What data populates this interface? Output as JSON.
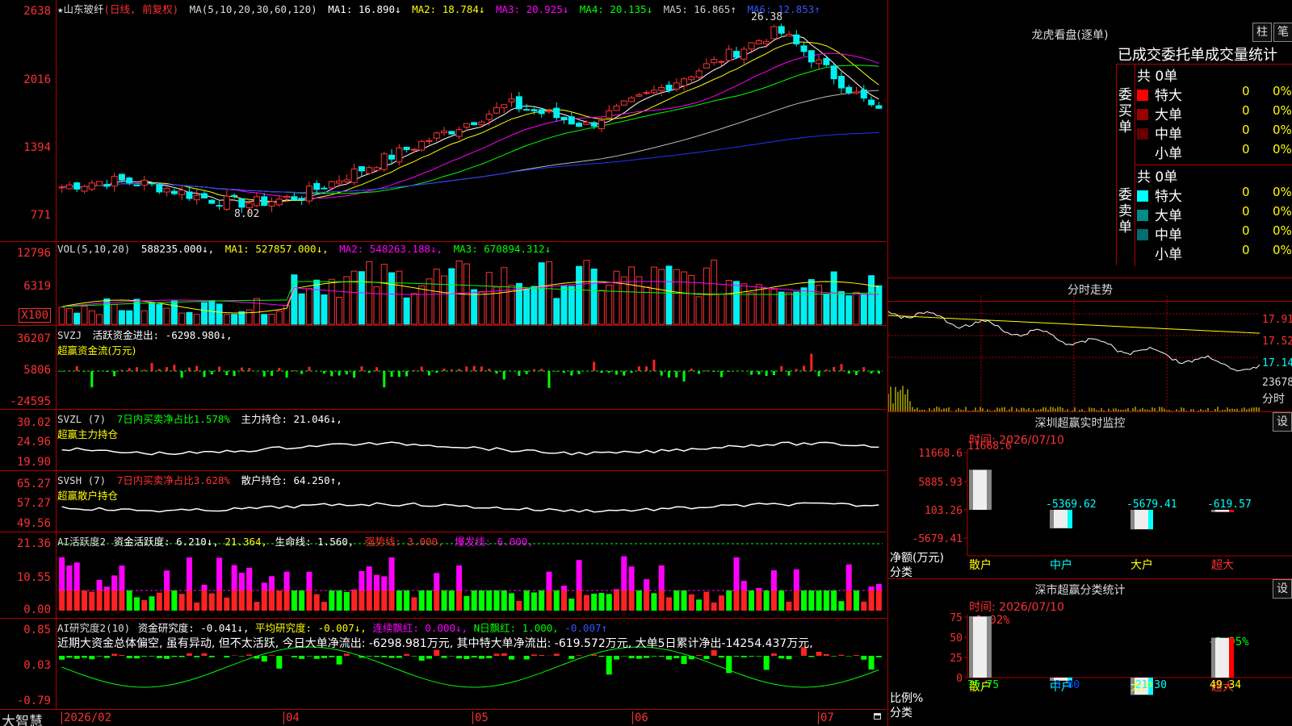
{
  "app": {
    "logo": "大智慧"
  },
  "colors": {
    "up": "#ff3333",
    "down": "#00f0f0",
    "bg": "#000000",
    "grid": "#b00000",
    "green": "#00ff00",
    "magenta": "#ff00ff",
    "yellow": "#ffff00"
  },
  "price_panel": {
    "title": "★山东玻纤",
    "period": "(日线, 前复权)",
    "ma_params": "MA(5,10,20,30,60,120)",
    "ma": [
      {
        "label": "MA1: 16.890↓",
        "color": "#ffffff"
      },
      {
        "label": "MA2: 18.784↓",
        "color": "#ffff00"
      },
      {
        "label": "MA3: 20.925↓",
        "color": "#ff00ff"
      },
      {
        "label": "MA4: 20.135↓",
        "color": "#00ff00"
      },
      {
        "label": "MA5: 16.865↑",
        "color": "#cccccc"
      },
      {
        "label": "MA6: 12.853↑",
        "color": "#0000ff"
      }
    ],
    "yticks": [
      "2638",
      "2016",
      "1394",
      "771"
    ],
    "high_label": "26.38",
    "low_label": "8.02"
  },
  "vol_panel": {
    "title": "VOL(5,10,20)",
    "value": "588235.000↓,",
    "ma": [
      {
        "label": "MA1: 527857.000↓,",
        "color": "#ffff00"
      },
      {
        "label": "MA2: 548263.188↓,",
        "color": "#ff00ff"
      },
      {
        "label": "MA3: 670894.312↓",
        "color": "#00ff00"
      }
    ],
    "yticks": [
      "12796",
      "6319"
    ],
    "unit": "X100"
  },
  "svzj_panel": {
    "title": "SVZJ",
    "line1": "活跃资金进出: -6298.980↓,",
    "line2": "超赢资金流(万元)",
    "yticks": [
      "36207",
      "5806",
      "-24595"
    ]
  },
  "svzl_panel": {
    "title": "SVZL (7)",
    "ratio": "7日内买卖净占比1.578%",
    "hold": "主力持仓: 21.046↓,",
    "line2": "超赢主力持仓",
    "yticks": [
      "30.02",
      "24.96",
      "19.90"
    ]
  },
  "svsh_panel": {
    "title": "SVSH (7)",
    "ratio": "7日内买卖净占比3.628%",
    "hold": "散户持仓: 64.250↑,",
    "line2": "超赢散户持仓",
    "yticks": [
      "65.27",
      "57.27",
      "49.56"
    ]
  },
  "ai_active_panel": {
    "title": "AI活跃度2",
    "items": [
      {
        "label": "资金活跃度: 6.210↓,",
        "color": "#ffffff"
      },
      {
        "label": "21.364,",
        "color": "#ffff00"
      },
      {
        "label": "生命线: 1.560,",
        "color": "#ffffff"
      },
      {
        "label": "强势线: 3.000,",
        "color": "#ff3030"
      },
      {
        "label": "爆发线: 6.000,",
        "color": "#ff00ff"
      }
    ],
    "yticks": [
      "21.36",
      "10.55",
      "0.00"
    ]
  },
  "ai_research_panel": {
    "title": "AI研究度2(10)",
    "items": [
      {
        "label": "资金研究度: -0.041↓,",
        "color": "#ffffff"
      },
      {
        "label": "平均研究度: -0.007↓,",
        "color": "#ffff00"
      },
      {
        "label": "连续飘红: 0.000↓,",
        "color": "#ff00ff"
      },
      {
        "label": "N日飘红: 1.000,",
        "color": "#00ff00"
      },
      {
        "label": "-0.007↑",
        "color": "#0000ff"
      }
    ],
    "comment": "近期大资金总体偏空, 虽有异动, 但不太活跃, 今日大单净流出: -6298.981万元, 其中特大单净流出: -619.572万元, 大单5日累计净出-14254.437万元,",
    "yticks": [
      "0.85",
      "0.03",
      "-0.79"
    ]
  },
  "time_axis": [
    "2026/02",
    "04",
    "05",
    "06",
    "07"
  ],
  "lhb": {
    "title": "龙虎看盘(逐单)",
    "btn1": "柱",
    "btn2": "笔",
    "tabs": "已成交委托单成交量统计",
    "buy_label": "委买单",
    "sell_label": "委卖单",
    "buy_total": "共 0单",
    "sell_total": "共 0单",
    "buy_rows": [
      {
        "name": "特大",
        "count": "0",
        "pct": "0%",
        "color": "#ff0000"
      },
      {
        "name": "大单",
        "count": "0",
        "pct": "0%",
        "color": "#990000"
      },
      {
        "name": "中单",
        "count": "0",
        "pct": "0%",
        "color": "#660000"
      },
      {
        "name": "小单",
        "count": "0",
        "pct": "0%",
        "color": ""
      }
    ],
    "sell_rows": [
      {
        "name": "特大",
        "count": "0",
        "pct": "0%",
        "color": "#00ffff"
      },
      {
        "name": "大单",
        "count": "0",
        "pct": "0%",
        "color": "#008b8b"
      },
      {
        "name": "中单",
        "count": "0",
        "pct": "0%",
        "color": "#006e6e"
      },
      {
        "name": "小单",
        "count": "0",
        "pct": "0%",
        "color": ""
      }
    ]
  },
  "intraday": {
    "title": "分时走势",
    "prices": [
      "17.91",
      "17.52",
      "17.14"
    ],
    "vol": "23678",
    "vol_unit": "分时"
  },
  "sz_monitor": {
    "title": "深圳超赢实时监控",
    "btn": "设",
    "time": "时间: 2026/07/10",
    "yticks": [
      "11668.6",
      "5885.93",
      "103.26",
      "-5679.41"
    ],
    "ylabel1": "净额(万元)",
    "ylabel2": "分类",
    "bars": [
      {
        "cat": "散户",
        "value": 11668.6,
        "label": "11668.6",
        "cat_color": "#ffff00",
        "label_color": "#ff3030"
      },
      {
        "cat": "中户",
        "value": -5369.62,
        "label": "-5369.62",
        "cat_color": "#00ffff",
        "label_color": "#00ffff"
      },
      {
        "cat": "大户",
        "value": -5679.41,
        "label": "-5679.41",
        "cat_color": "#ffff00",
        "label_color": "#00ffff"
      },
      {
        "cat": "超大",
        "value": -619.57,
        "label": "-619.57",
        "cat_color": "#ff3030",
        "label_color": "#00ffff"
      }
    ]
  },
  "sz_stats": {
    "title": "深市超赢分类统计",
    "btn": "设",
    "time": "时间: 2026/07/10",
    "yticks": [
      "75",
      "50",
      "25",
      "0"
    ],
    "ylabel1": "比例%",
    "ylabel2": "分类",
    "top_labels": [
      {
        "label": "+1.02%",
        "color": "#ff3030"
      },
      {
        "label": "-0.05%",
        "color": "#00ff00"
      }
    ],
    "bars": [
      {
        "cat": "散户",
        "value": 75.75,
        "label": "75.75",
        "cat_color": "#ffff00",
        "label_color": "#00ff00"
      },
      {
        "cat": "中户",
        "value": -3.8,
        "label": "-3.80",
        "cat_color": "#00ffff",
        "label_color": "#0055ff"
      },
      {
        "cat": "大户",
        "value": -21.3,
        "label": "-21.30",
        "cat_color": "#ffff00",
        "label_color": "#00ffff"
      },
      {
        "cat": "超大",
        "value": 49.34,
        "label": "49.34",
        "cat_color": "#ff3030",
        "label_color": "#ffff00"
      }
    ]
  }
}
